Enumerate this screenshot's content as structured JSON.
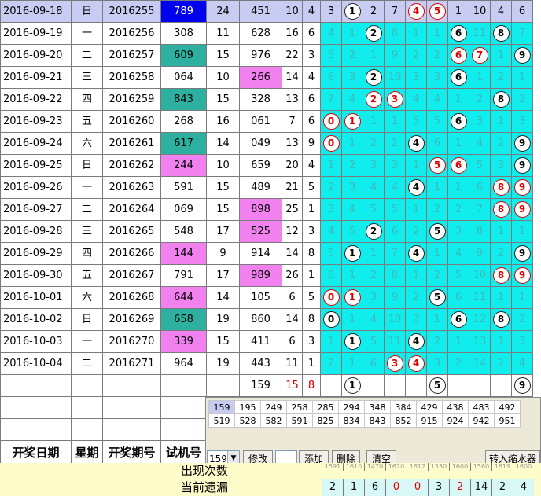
{
  "rows": [
    {
      "date": "2016-09-18",
      "weekday": "日",
      "issue": "2016255",
      "try": "789",
      "sum_try": "24",
      "draw": "451",
      "sum_draw": "10",
      "span": "4",
      "cells": [
        "3",
        {
          "b": "1"
        },
        "2",
        "7",
        {
          "b": "4",
          "r": true
        },
        {
          "b": "5",
          "r": true
        },
        "1",
        "10",
        "4",
        "6"
      ]
    },
    {
      "date": "2016-09-19",
      "weekday": "一",
      "issue": "2016256",
      "try": "308",
      "sum_try": "11",
      "draw": "628",
      "sum_draw": "16",
      "span": "6",
      "cells": [
        "4",
        "1",
        {
          "b": "2"
        },
        "8",
        "1",
        "1",
        {
          "b": "6"
        },
        "11",
        {
          "b": "8"
        },
        "7"
      ]
    },
    {
      "date": "2016-09-20",
      "weekday": "二",
      "issue": "2016257",
      "try": "609",
      "sum_try": "15",
      "draw": "976",
      "sum_draw": "22",
      "span": "3",
      "cells": [
        "5",
        "2",
        "1",
        "9",
        "2",
        "2",
        {
          "b": "6",
          "r": true
        },
        {
          "b": "7",
          "r": true
        },
        "1",
        {
          "b": "9"
        }
      ]
    },
    {
      "date": "2016-09-21",
      "weekday": "三",
      "issue": "2016258",
      "try": "064",
      "sum_try": "10",
      "draw": "266",
      "sum_draw": "14",
      "span": "4",
      "cells": [
        "6",
        "3",
        {
          "b": "2"
        },
        "10",
        "3",
        "3",
        {
          "b": "6"
        },
        "1",
        "2",
        "1"
      ]
    },
    {
      "date": "2016-09-22",
      "weekday": "四",
      "issue": "2016259",
      "try": "843",
      "sum_try": "15",
      "draw": "328",
      "sum_draw": "13",
      "span": "6",
      "cells": [
        "7",
        "4",
        {
          "b": "2",
          "r": true
        },
        {
          "b": "3",
          "r": true
        },
        "4",
        "4",
        "1",
        "2",
        {
          "b": "8"
        },
        "2"
      ]
    },
    {
      "date": "2016-09-23",
      "weekday": "五",
      "issue": "2016260",
      "try": "268",
      "sum_try": "16",
      "draw": "061",
      "sum_draw": "7",
      "span": "6",
      "cells": [
        {
          "b": "0",
          "r": true
        },
        {
          "b": "1",
          "r": true
        },
        "1",
        "1",
        "5",
        "5",
        {
          "b": "6"
        },
        "3",
        "1",
        "3"
      ]
    },
    {
      "date": "2016-09-24",
      "weekday": "六",
      "issue": "2016261",
      "try": "617",
      "sum_try": "14",
      "draw": "049",
      "sum_draw": "13",
      "span": "9",
      "cells": [
        {
          "b": "0",
          "r": true
        },
        "1",
        "2",
        "2",
        {
          "b": "4"
        },
        "6",
        "1",
        "4",
        "2",
        {
          "b": "9"
        }
      ]
    },
    {
      "date": "2016-09-25",
      "weekday": "日",
      "issue": "2016262",
      "try": "244",
      "sum_try": "10",
      "draw": "659",
      "sum_draw": "20",
      "span": "4",
      "cells": [
        "1",
        "2",
        "3",
        "3",
        "1",
        {
          "b": "5",
          "r": true
        },
        {
          "b": "6",
          "r": true
        },
        "5",
        "3",
        {
          "b": "9"
        }
      ]
    },
    {
      "date": "2016-09-26",
      "weekday": "一",
      "issue": "2016263",
      "try": "591",
      "sum_try": "15",
      "draw": "489",
      "sum_draw": "21",
      "span": "5",
      "cells": [
        "2",
        "3",
        "4",
        "4",
        {
          "b": "4"
        },
        "1",
        "1",
        "6",
        {
          "b": "8",
          "r": true
        },
        {
          "b": "9",
          "r": true
        }
      ]
    },
    {
      "date": "2016-09-27",
      "weekday": "二",
      "issue": "2016264",
      "try": "069",
      "sum_try": "15",
      "draw": "898",
      "sum_draw": "25",
      "span": "1",
      "cells": [
        "3",
        "4",
        "5",
        "5",
        "1",
        "2",
        "2",
        "7",
        {
          "b": "8",
          "r": true
        },
        {
          "b": "9",
          "r": true
        }
      ]
    },
    {
      "date": "2016-09-28",
      "weekday": "三",
      "issue": "2016265",
      "try": "548",
      "sum_try": "17",
      "draw": "525",
      "sum_draw": "12",
      "span": "3",
      "cells": [
        "4",
        "5",
        {
          "b": "2"
        },
        "6",
        "2",
        {
          "b": "5"
        },
        "3",
        "8",
        "1",
        "1"
      ]
    },
    {
      "date": "2016-09-29",
      "weekday": "四",
      "issue": "2016266",
      "try": "144",
      "sum_try": "9",
      "draw": "914",
      "sum_draw": "14",
      "span": "8",
      "cells": [
        "5",
        {
          "b": "1"
        },
        "1",
        "7",
        {
          "b": "4"
        },
        "1",
        "4",
        "9",
        "2",
        {
          "b": "9"
        }
      ]
    },
    {
      "date": "2016-09-30",
      "weekday": "五",
      "issue": "2016267",
      "try": "791",
      "sum_try": "17",
      "draw": "989",
      "sum_draw": "26",
      "span": "1",
      "cells": [
        "6",
        "1",
        "2",
        "8",
        "1",
        "2",
        "5",
        "10",
        {
          "b": "8",
          "r": true
        },
        {
          "b": "9",
          "r": true
        }
      ]
    },
    {
      "date": "2016-10-01",
      "weekday": "六",
      "issue": "2016268",
      "try": "644",
      "sum_try": "14",
      "draw": "105",
      "sum_draw": "6",
      "span": "5",
      "cells": [
        {
          "b": "0",
          "r": true
        },
        {
          "b": "1",
          "r": true
        },
        "3",
        "9",
        "2",
        {
          "b": "5"
        },
        "6",
        "11",
        "1",
        "1"
      ]
    },
    {
      "date": "2016-10-02",
      "weekday": "日",
      "issue": "2016269",
      "try": "658",
      "sum_try": "19",
      "draw": "860",
      "sum_draw": "14",
      "span": "8",
      "cells": [
        {
          "b": "0"
        },
        "1",
        "4",
        "10",
        "3",
        "1",
        {
          "b": "6"
        },
        "12",
        {
          "b": "8"
        },
        "2"
      ]
    },
    {
      "date": "2016-10-03",
      "weekday": "一",
      "issue": "2016270",
      "try": "339",
      "sum_try": "15",
      "draw": "411",
      "sum_draw": "6",
      "span": "3",
      "cells": [
        "1",
        {
          "b": "1"
        },
        "5",
        "11",
        {
          "b": "4"
        },
        "2",
        "1",
        "13",
        "1",
        "3"
      ]
    },
    {
      "date": "2016-10-04",
      "weekday": "二",
      "issue": "2016271",
      "try": "964",
      "sum_try": "19",
      "draw": "443",
      "sum_draw": "11",
      "span": "1",
      "cells": [
        "2",
        "1",
        "6",
        {
          "b": "3",
          "r": true
        },
        {
          "b": "4",
          "r": true
        },
        "3",
        "2",
        "14",
        "2",
        "4"
      ]
    }
  ],
  "try_colors": [
    "",
    "",
    "hl-t",
    "",
    "hl-t",
    "",
    "hl-t",
    "hl-p",
    "",
    "",
    "",
    "hl-p",
    "",
    "hl-p",
    "hl-t",
    "hl-p",
    ""
  ],
  "draw_colors": [
    "",
    "",
    "",
    "hl-p",
    "",
    "",
    "",
    "",
    "",
    "hl-p",
    "hl-p",
    "",
    "hl-p",
    "",
    "",
    "",
    ""
  ],
  "predict_row": {
    "draw": "159",
    "sum_draw": "15",
    "span": "8",
    "balls": {
      "1": "1",
      "5": "5",
      "9": "9"
    }
  },
  "header": {
    "date": "开奖日期",
    "weekday": "星期",
    "issue": "开奖期号",
    "try": "试机号"
  },
  "panel": {
    "numbers": [
      [
        "159",
        "195",
        "249",
        "258",
        "285",
        "294",
        "348",
        "384",
        "429",
        "438",
        "483",
        "492"
      ],
      [
        "519",
        "528",
        "582",
        "591",
        "825",
        "834",
        "843",
        "852",
        "915",
        "924",
        "942",
        "951"
      ]
    ],
    "select_value": "159",
    "modify": "修改",
    "add": "添加",
    "delete": "删除",
    "clear": "清空",
    "shrink": "转入缩水器"
  },
  "footer": {
    "count_label": "出现次数",
    "miss_label": "当前遗漏",
    "counts_small": [
      "1591",
      "1610",
      "1470",
      "1620",
      "1612",
      "1530",
      "1600",
      "1560",
      "1619",
      "1600"
    ],
    "miss": [
      "2",
      "1",
      "6",
      "0",
      "0",
      "3",
      "2",
      "14",
      "2",
      "4"
    ],
    "miss_red": [
      false,
      false,
      false,
      true,
      true,
      false,
      true,
      false,
      false,
      false
    ]
  }
}
